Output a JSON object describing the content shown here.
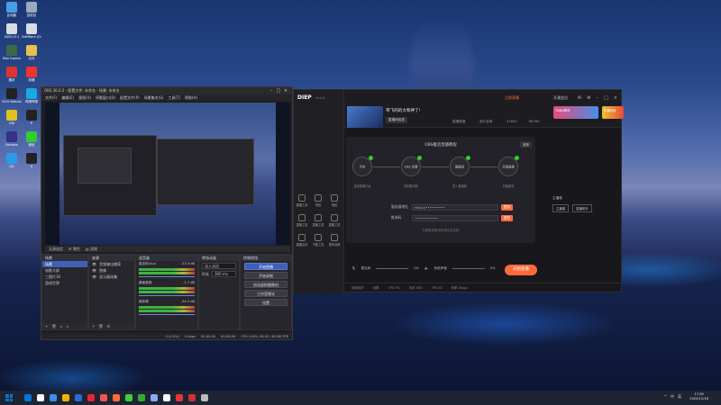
{
  "desktop": {
    "icons": [
      {
        "label": "此电脑",
        "color": "#4a9ee8"
      },
      {
        "label": "回收站",
        "color": "#9aa8c0"
      },
      {
        "label": "DATA (E:)",
        "color": "#d7dbe4"
      },
      {
        "label": "SoftWare (D:)",
        "color": "#d7dbe4"
      },
      {
        "label": "Mall Games",
        "color": "#3a6a4a"
      },
      {
        "label": "文件",
        "color": "#e8c04a"
      },
      {
        "label": "素材",
        "color": "#d33"
      },
      {
        "label": "剪辑",
        "color": "#e33"
      },
      {
        "label": "ROG Nebula",
        "color": "#222"
      },
      {
        "label": "哔哩哔哩",
        "color": "#1aa8e0"
      },
      {
        "label": "UNI",
        "color": "#e0c020"
      },
      {
        "label": "H",
        "color": "#222"
      },
      {
        "label": "Remote",
        "color": "#338"
      },
      {
        "label": "微信",
        "color": "#3c3"
      },
      {
        "label": "QQ",
        "color": "#2a9be8"
      },
      {
        "label": "A",
        "color": "#222"
      }
    ]
  },
  "obs": {
    "title": "OBS 30.0.2 - 配置文件: 未命名 - 场景: 未命名",
    "menu": [
      "文件(F)",
      "编辑(E)",
      "视图(V)",
      "停靠窗口(D)",
      "配置文件(P)",
      "场景集合(S)",
      "工具(T)",
      "帮助(H)"
    ],
    "source_bar": {
      "label": "无源选定",
      "props": "属性",
      "filters": "滤镜"
    },
    "scenes": {
      "title": "场景",
      "items": [
        "场景",
        "电影大屏",
        "三图片16",
        "游戏世界"
      ]
    },
    "sources": {
      "title": "来源",
      "items": [
        "音频输出捕获",
        "图像",
        "显示器采集"
      ]
    },
    "mixer": {
      "title": "混音器",
      "channels": [
        {
          "name": "麦克风/Aux",
          "level": "-23.3 dB"
        },
        {
          "name": "桌面音频",
          "level": "-1.7 dB"
        },
        {
          "name": "媒体源",
          "level": "-54.3 dB"
        }
      ]
    },
    "transitions": {
      "title": "转场动画",
      "type": "淡入淡出",
      "duration_label": "时长",
      "duration": "300 ms"
    },
    "controls": {
      "title": "控制按钮",
      "buttons": [
        "开始直播",
        "开始录制",
        "启动虚拟摄像机",
        "工作室模式",
        "设置"
      ]
    },
    "status": {
      "dropped": "0 (0.0%)",
      "bitrate": "0 kbps",
      "rec_time": "00:00:00",
      "live_time": "00:00:00",
      "cpu": "CPU: 0.8%, 60.00 / 60.00 FPS"
    }
  },
  "assistant": {
    "logo": "DIEP",
    "version": "v5.5.4",
    "room_title": "带飞的的大和神了!",
    "room_badge": "直播间信息",
    "stats": [
      "直播数据",
      "观众名单",
      "4165A",
      "66789"
    ],
    "top_action": "立即直播",
    "vip_label": "开通会员",
    "banner_labels": [
      "TNNN周年",
      "风暴科技"
    ],
    "side_items": [
      "直播工具",
      "场景",
      "场景",
      "直播工具",
      "直播工具",
      "直播工具",
      "直播互动",
      "下载工具",
      "更多设置"
    ],
    "flow": {
      "title": "OBS推流直播教程",
      "tag": "推荐",
      "nodes": [
        {
          "label": "平台",
          "caption": "选择直播平台"
        },
        {
          "label": "OBS 设置",
          "caption": "复制推流码"
        },
        {
          "label": "直播间",
          "caption": "进入直播间"
        },
        {
          "label": "开始直播",
          "caption": "开始推流"
        }
      ]
    },
    "server_label": "服务器地址",
    "server_value": "rtmp://••••••••••",
    "key_label": "推流码",
    "key_value": "••••••••••••",
    "copy_label": "复制",
    "hint": "长期有效推流码请点击复制",
    "bottom_tools": [
      "麦克风",
      "系统声音"
    ],
    "vol_values": [
      "0%",
      "0%"
    ],
    "go_live": "开始直播",
    "footer": [
      "网络良好",
      "设置",
      "CPU 0%",
      "内存 48%",
      "FPS 60",
      "码率 0kbps"
    ],
    "right_panel": [
      "主播端",
      "直播助手"
    ]
  },
  "taskbar": {
    "time": "17:00",
    "date": "2025/12/16",
    "tray": [
      "^",
      "中",
      "英"
    ],
    "apps": [
      "#0078d7",
      "#ffffff",
      "#3a8ee8",
      "#f0b400",
      "#2a6ad4",
      "#e23",
      "#e55",
      "#ff6a3d",
      "#4c4",
      "#3a3",
      "#8af",
      "#fff",
      "#e33",
      "#c33",
      "#bbb"
    ]
  }
}
